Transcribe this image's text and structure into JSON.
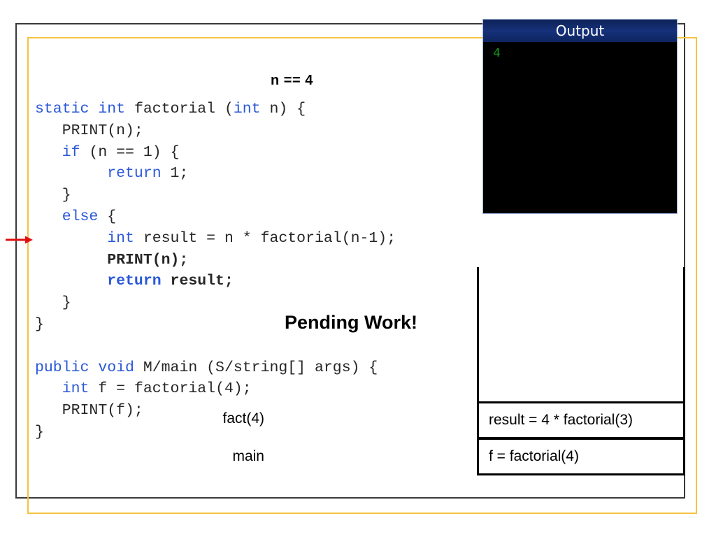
{
  "slide": {
    "frames": {
      "outer_color": "#3a3a3a",
      "inner_color": "#f5c342"
    }
  },
  "annotations": {
    "current_arg": "n == 4",
    "pending_work": "Pending Work!",
    "step_arrow": "red-right-arrow"
  },
  "code": {
    "language": "java-like-pseudocode",
    "keyword_color": "#2a58d8",
    "lines": [
      [
        {
          "t": "static ",
          "k": true,
          "b": false
        },
        {
          "t": "int ",
          "k": true,
          "b": false
        },
        {
          "t": "factorial (",
          "k": false,
          "b": false
        },
        {
          "t": "int",
          "k": true,
          "b": false
        },
        {
          "t": " n) {",
          "k": false,
          "b": false
        }
      ],
      [
        {
          "t": "   PRINT(n);",
          "k": false,
          "b": false
        }
      ],
      [
        {
          "t": "   ",
          "k": false,
          "b": false
        },
        {
          "t": "if",
          "k": true,
          "b": false
        },
        {
          "t": " (n == 1) {",
          "k": false,
          "b": false
        }
      ],
      [
        {
          "t": "        ",
          "k": false,
          "b": false
        },
        {
          "t": "return",
          "k": true,
          "b": false
        },
        {
          "t": " 1;",
          "k": false,
          "b": false
        }
      ],
      [
        {
          "t": "   }",
          "k": false,
          "b": false
        }
      ],
      [
        {
          "t": "   ",
          "k": false,
          "b": false
        },
        {
          "t": "else",
          "k": true,
          "b": false
        },
        {
          "t": " {",
          "k": false,
          "b": false
        }
      ],
      [
        {
          "t": "        ",
          "k": false,
          "b": false
        },
        {
          "t": "int",
          "k": true,
          "b": false
        },
        {
          "t": " result = n * factorial(n-1);",
          "k": false,
          "b": false
        }
      ],
      [
        {
          "t": "        PRINT(n);",
          "k": false,
          "b": true
        }
      ],
      [
        {
          "t": "        ",
          "k": false,
          "b": false
        },
        {
          "t": "return",
          "k": true,
          "b": true
        },
        {
          "t": " result;",
          "k": false,
          "b": true
        }
      ],
      [
        {
          "t": "   }",
          "k": false,
          "b": false
        }
      ],
      [
        {
          "t": "}",
          "k": false,
          "b": false
        }
      ],
      [
        {
          "t": "",
          "k": false,
          "b": false
        }
      ],
      [
        {
          "t": "public ",
          "k": true,
          "b": false
        },
        {
          "t": "void ",
          "k": true,
          "b": false
        },
        {
          "t": "M/main (S/string[] args) {",
          "k": false,
          "b": false
        }
      ],
      [
        {
          "t": "   ",
          "k": false,
          "b": false
        },
        {
          "t": "int",
          "k": true,
          "b": false
        },
        {
          "t": " f = factorial(4);",
          "k": false,
          "b": false
        }
      ],
      [
        {
          "t": "   PRINT(f);",
          "k": false,
          "b": false
        }
      ],
      [
        {
          "t": "}",
          "k": false,
          "b": false
        }
      ]
    ]
  },
  "output_panel": {
    "title": "Output",
    "console_text": "4",
    "title_bg": "#102a63",
    "console_bg": "#000000",
    "console_fg": "#17a017"
  },
  "call_stack": {
    "frames": [
      {
        "label": "fact(4)",
        "content": "result = 4 * factorial(3)"
      },
      {
        "label": "main",
        "content": "f = factorial(4)"
      }
    ]
  }
}
